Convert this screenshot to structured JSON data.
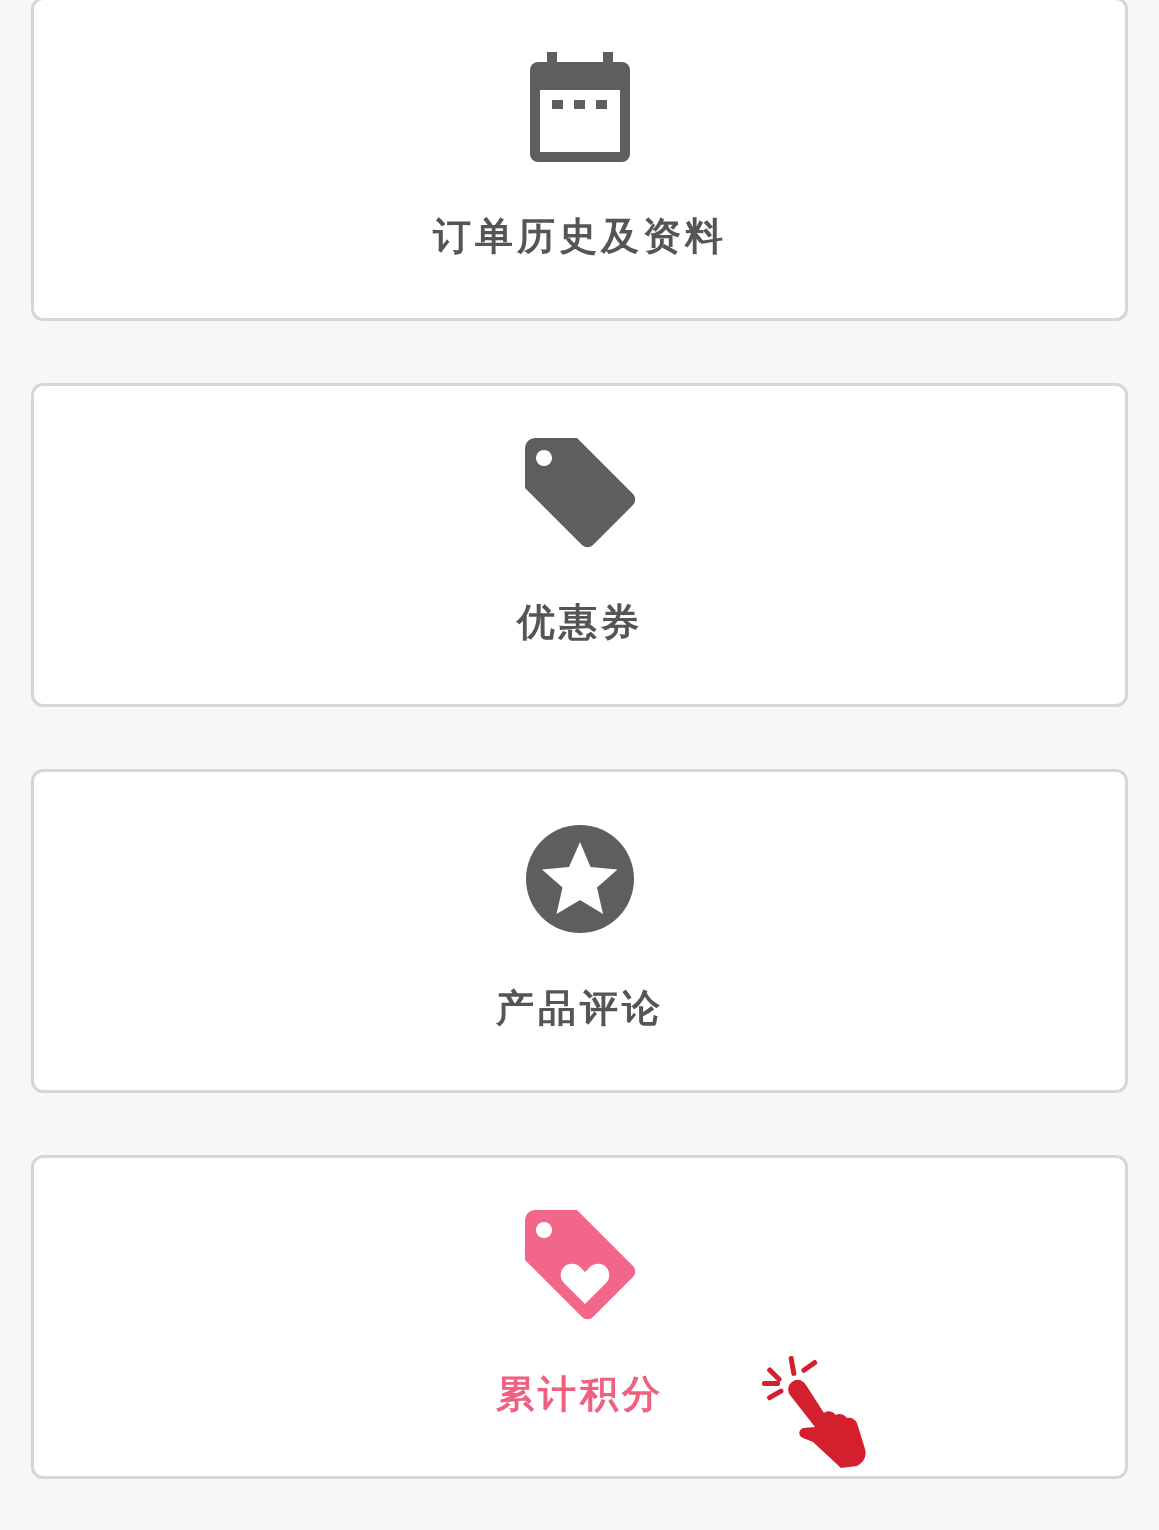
{
  "menu": [
    {
      "label": "订单历史及资料",
      "kind": "calendar",
      "selected": false
    },
    {
      "label": "优惠券",
      "kind": "tag",
      "selected": false
    },
    {
      "label": "产品评论",
      "kind": "star",
      "selected": false
    },
    {
      "label": "累计积分",
      "kind": "points",
      "selected": true
    }
  ]
}
